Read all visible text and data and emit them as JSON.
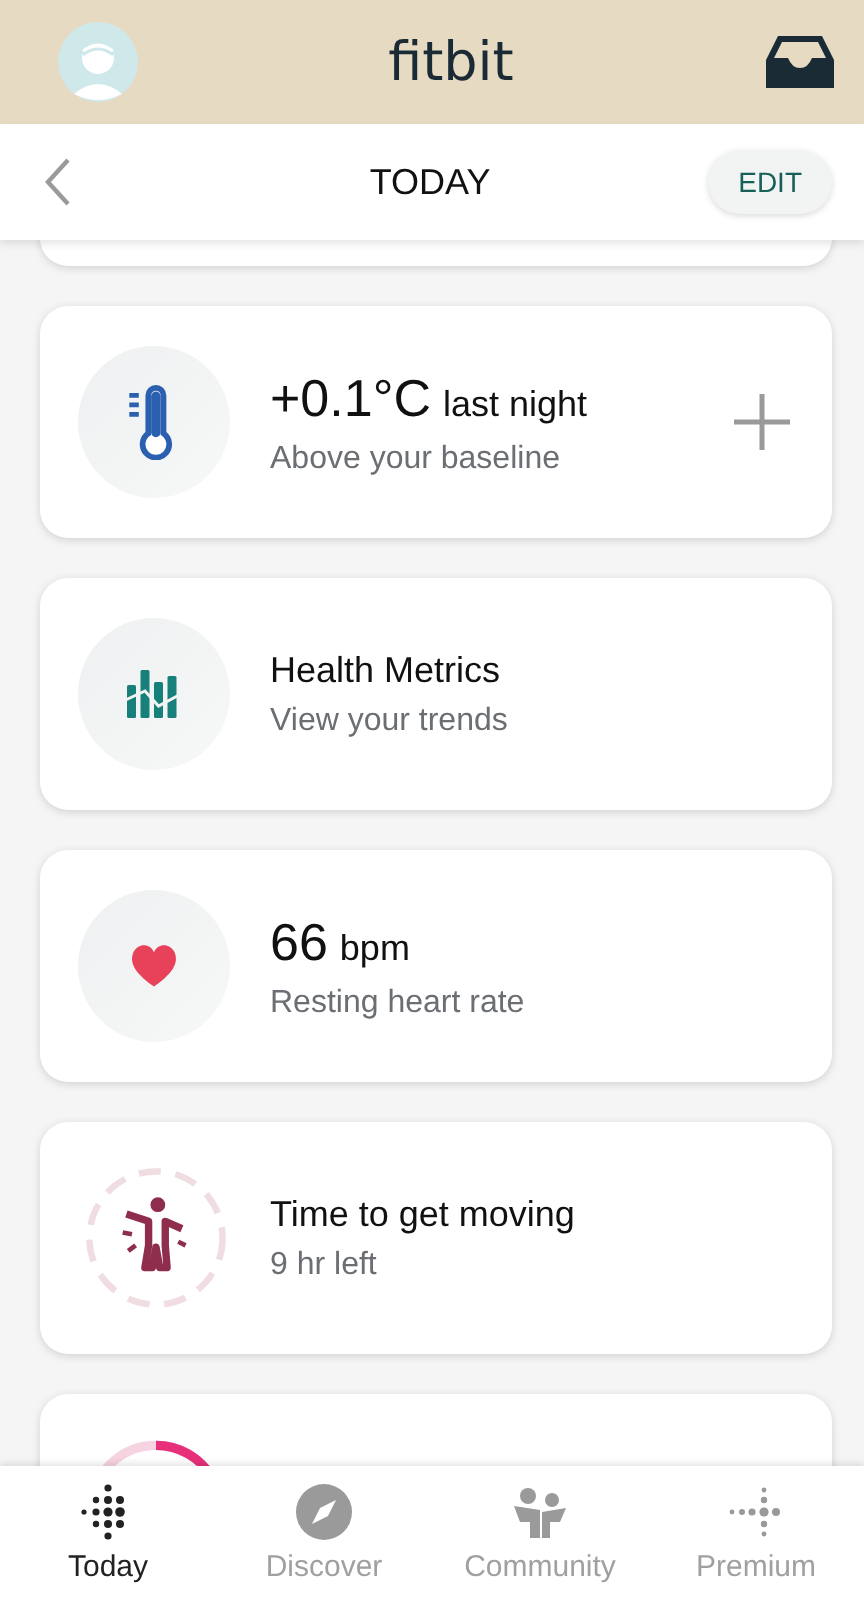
{
  "app_bar": {
    "logo": "fitbit"
  },
  "header": {
    "title": "TODAY",
    "edit_button": "EDIT"
  },
  "cards": [
    {
      "kind": "temperature",
      "value": "+0.1°C",
      "unit": "last night",
      "subtitle": "Above your baseline",
      "has_add": true
    },
    {
      "kind": "metrics",
      "title": "Health Metrics",
      "subtitle": "View your trends",
      "has_add": false
    },
    {
      "kind": "heart",
      "value": "66",
      "unit": "bpm",
      "subtitle": "Resting heart rate",
      "has_add": false
    },
    {
      "kind": "move",
      "title": "Time to get moving",
      "subtitle": "9 hr left",
      "has_add": false
    },
    {
      "kind": "steps_ring",
      "has_add": false
    }
  ],
  "tabs": [
    {
      "label": "Today",
      "kind": "today",
      "selected": true
    },
    {
      "label": "Discover",
      "kind": "discover",
      "selected": false
    },
    {
      "label": "Community",
      "kind": "community",
      "selected": false
    },
    {
      "label": "Premium",
      "kind": "premium",
      "selected": false
    }
  ]
}
